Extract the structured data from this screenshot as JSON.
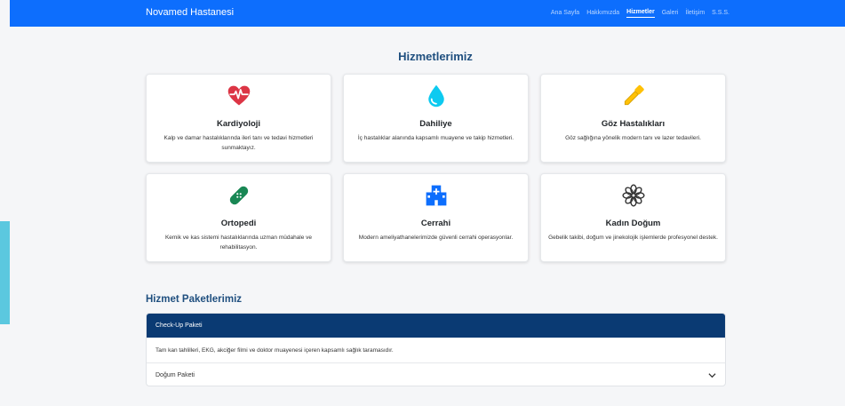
{
  "navbar": {
    "brand": "Novamed Hastanesi",
    "links": [
      "Ana Sayfa",
      "Hakkımızda",
      "Hizmetler",
      "Galeri",
      "İletişim",
      "S.S.S."
    ],
    "active": "Hizmetler"
  },
  "services": {
    "title": "Hizmetlerimiz",
    "cards": [
      {
        "title": "Kardiyoloji",
        "text": "Kalp ve damar hastalıklarında ileri tanı ve tedavi hizmetleri sunmaktayız.",
        "icon": "heart-pulse-icon"
      },
      {
        "title": "Dahiliye",
        "text": "İç hastalıklar alanında kapsamlı muayene ve takip hizmetleri.",
        "icon": "droplet-icon"
      },
      {
        "title": "Göz Hastalıkları",
        "text": "Göz sağlığına yönelik modern tanı ve lazer tedavileri.",
        "icon": "eyedropper-icon"
      },
      {
        "title": "Ortopedi",
        "text": "Kemik ve kas sistemi hastalıklarında uzman müdahale ve rehabilitasyon.",
        "icon": "bandage-icon"
      },
      {
        "title": "Cerrahi",
        "text": "Modern ameliyathanelerimizde güvenli cerrahi operasyonlar.",
        "icon": "hospital-icon"
      },
      {
        "title": "Kadın Doğum",
        "text": "Gebelik takibi, doğum ve jinekolojik işlemlerde profesyonel destek.",
        "icon": "flower-icon"
      }
    ]
  },
  "packages": {
    "title": "Hizmet Paketlerimiz",
    "items": [
      {
        "title": "Check-Up Paketi",
        "body": "Tam kan tahlilleri, EKG, akciğer filmi ve doktor muayenesi içeren kapsamlı sağlık taramasıdır."
      },
      {
        "title": "Doğum Paketi"
      }
    ]
  },
  "colors": {
    "navbar": "#0d6efd",
    "heading": "#1f4f7f",
    "accordion_active": "#0a3a73",
    "heart": "#dc3545",
    "droplet": "#0dcaf0",
    "eyedropper": "#ffc107",
    "bandage": "#198754",
    "hospital": "#0d6efd",
    "flower": "#333333",
    "left_accent": "#5bc8df"
  }
}
